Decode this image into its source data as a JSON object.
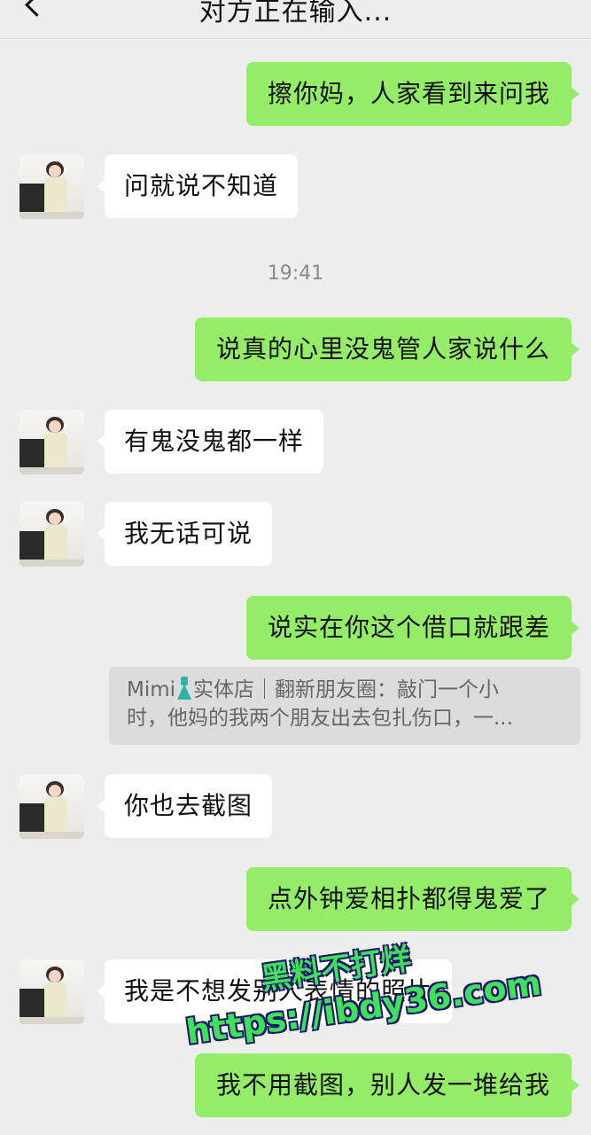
{
  "header": {
    "title": "对方正在输入..."
  },
  "messages": [
    {
      "text": "擦你妈，人家看到来问我"
    },
    {
      "text": "问就说不知道"
    },
    {
      "text": "说真的心里没鬼管人家说什么"
    },
    {
      "text": "有鬼没鬼都一样"
    },
    {
      "text": "我无话可说"
    },
    {
      "text": "说实在你这个借口就跟差"
    },
    {
      "text": "你也去截图"
    },
    {
      "text": "点外钟爱相扑都得鬼爱了"
    },
    {
      "text": "我是不想发别人表情的照片"
    },
    {
      "text": "我不用截图，别人发一堆给我"
    }
  ],
  "timestamp": "19:41",
  "quote": {
    "name": "Mimi",
    "icon": "dress-icon",
    "line1_after_name": "实体店｜翻新朋友圈：敲门一个小",
    "line2": "时，他妈的我两个朋友出去包扎伤口，一..."
  },
  "watermark": {
    "line1": "黑料不打烊",
    "line2": "https://ibdy36.com"
  },
  "colors": {
    "background": "#ededed",
    "outgoing_bubble": "#95ec69",
    "incoming_bubble": "#ffffff",
    "quote_bg": "#dcdcdc",
    "watermark": "#3fe05a"
  }
}
